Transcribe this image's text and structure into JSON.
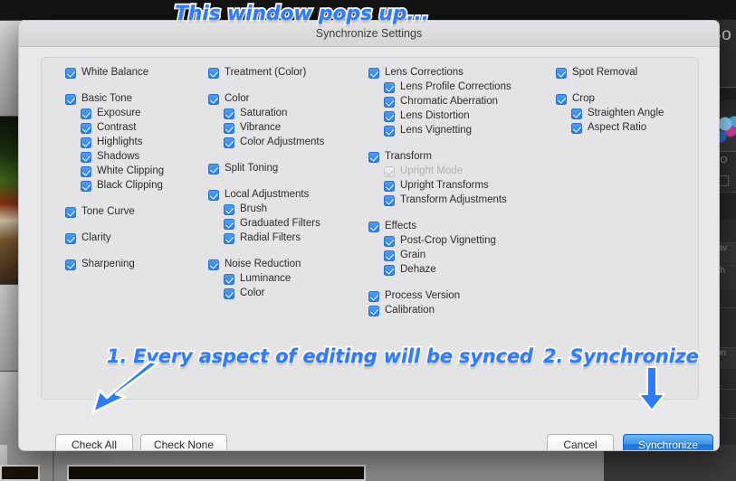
{
  "background": {
    "panel_title": "Bo",
    "iso_label": "ISO",
    "row_sav": "Sav",
    "row_wh": "Wh",
    "row_ton": "Ton"
  },
  "dialog": {
    "title": "Synchronize Settings",
    "columns": [
      {
        "name": "column-1",
        "groups": [
          {
            "items": [
              {
                "label": "White Balance",
                "checked": true,
                "indent": 0,
                "disabled": false
              }
            ]
          },
          {
            "items": [
              {
                "label": "Basic Tone",
                "checked": true,
                "indent": 0,
                "disabled": false
              },
              {
                "label": "Exposure",
                "checked": true,
                "indent": 1,
                "disabled": false
              },
              {
                "label": "Contrast",
                "checked": true,
                "indent": 1,
                "disabled": false
              },
              {
                "label": "Highlights",
                "checked": true,
                "indent": 1,
                "disabled": false
              },
              {
                "label": "Shadows",
                "checked": true,
                "indent": 1,
                "disabled": false
              },
              {
                "label": "White Clipping",
                "checked": true,
                "indent": 1,
                "disabled": false
              },
              {
                "label": "Black Clipping",
                "checked": true,
                "indent": 1,
                "disabled": false
              }
            ]
          },
          {
            "items": [
              {
                "label": "Tone Curve",
                "checked": true,
                "indent": 0,
                "disabled": false
              }
            ]
          },
          {
            "items": [
              {
                "label": "Clarity",
                "checked": true,
                "indent": 0,
                "disabled": false
              }
            ]
          },
          {
            "items": [
              {
                "label": "Sharpening",
                "checked": true,
                "indent": 0,
                "disabled": false
              }
            ]
          }
        ]
      },
      {
        "name": "column-2",
        "groups": [
          {
            "items": [
              {
                "label": "Treatment (Color)",
                "checked": true,
                "indent": 0,
                "disabled": false
              }
            ]
          },
          {
            "items": [
              {
                "label": "Color",
                "checked": true,
                "indent": 0,
                "disabled": false
              },
              {
                "label": "Saturation",
                "checked": true,
                "indent": 1,
                "disabled": false
              },
              {
                "label": "Vibrance",
                "checked": true,
                "indent": 1,
                "disabled": false
              },
              {
                "label": "Color Adjustments",
                "checked": true,
                "indent": 1,
                "disabled": false
              }
            ]
          },
          {
            "items": [
              {
                "label": "Split Toning",
                "checked": true,
                "indent": 0,
                "disabled": false
              }
            ]
          },
          {
            "items": [
              {
                "label": "Local Adjustments",
                "checked": true,
                "indent": 0,
                "disabled": false
              },
              {
                "label": "Brush",
                "checked": true,
                "indent": 1,
                "disabled": false
              },
              {
                "label": "Graduated Filters",
                "checked": true,
                "indent": 1,
                "disabled": false
              },
              {
                "label": "Radial Filters",
                "checked": true,
                "indent": 1,
                "disabled": false
              }
            ]
          },
          {
            "items": [
              {
                "label": "Noise Reduction",
                "checked": true,
                "indent": 0,
                "disabled": false
              },
              {
                "label": "Luminance",
                "checked": true,
                "indent": 1,
                "disabled": false
              },
              {
                "label": "Color",
                "checked": true,
                "indent": 1,
                "disabled": false
              }
            ]
          }
        ]
      },
      {
        "name": "column-3",
        "groups": [
          {
            "items": [
              {
                "label": "Lens Corrections",
                "checked": true,
                "indent": 0,
                "disabled": false
              },
              {
                "label": "Lens Profile Corrections",
                "checked": true,
                "indent": 1,
                "disabled": false
              },
              {
                "label": "Chromatic Aberration",
                "checked": true,
                "indent": 1,
                "disabled": false
              },
              {
                "label": "Lens Distortion",
                "checked": true,
                "indent": 1,
                "disabled": false
              },
              {
                "label": "Lens Vignetting",
                "checked": true,
                "indent": 1,
                "disabled": false
              }
            ]
          },
          {
            "items": [
              {
                "label": "Transform",
                "checked": true,
                "indent": 0,
                "disabled": false
              },
              {
                "label": "Upright Mode",
                "checked": true,
                "indent": 1,
                "disabled": true
              },
              {
                "label": "Upright Transforms",
                "checked": true,
                "indent": 1,
                "disabled": false
              },
              {
                "label": "Transform Adjustments",
                "checked": true,
                "indent": 1,
                "disabled": false
              }
            ]
          },
          {
            "items": [
              {
                "label": "Effects",
                "checked": true,
                "indent": 0,
                "disabled": false
              },
              {
                "label": "Post-Crop Vignetting",
                "checked": true,
                "indent": 1,
                "disabled": false
              },
              {
                "label": "Grain",
                "checked": true,
                "indent": 1,
                "disabled": false
              },
              {
                "label": "Dehaze",
                "checked": true,
                "indent": 1,
                "disabled": false
              }
            ]
          },
          {
            "items": [
              {
                "label": "Process Version",
                "checked": true,
                "indent": 0,
                "disabled": false
              },
              {
                "label": "Calibration",
                "checked": true,
                "indent": 0,
                "disabled": false
              }
            ]
          }
        ]
      },
      {
        "name": "column-4",
        "groups": [
          {
            "items": [
              {
                "label": "Spot Removal",
                "checked": true,
                "indent": 0,
                "disabled": false
              }
            ]
          },
          {
            "items": [
              {
                "label": "Crop",
                "checked": true,
                "indent": 0,
                "disabled": false
              },
              {
                "label": "Straighten Angle",
                "checked": true,
                "indent": 1,
                "disabled": false
              },
              {
                "label": "Aspect Ratio",
                "checked": true,
                "indent": 1,
                "disabled": false
              }
            ]
          }
        ]
      }
    ],
    "buttons": {
      "check_all": "Check All",
      "check_none": "Check None",
      "cancel": "Cancel",
      "synchronize": "Synchronize"
    }
  },
  "annotations": {
    "top": "This window pops up...",
    "step1": "1. Every aspect of editing will be synced",
    "step2": "2. Synchronize"
  },
  "colors": {
    "accent_blue": "#2f7cf6",
    "checkbox_blue": "#2b7ee8",
    "sync_button_blue": "#1d74d8",
    "dialog_bg": "#e8e8ea"
  }
}
